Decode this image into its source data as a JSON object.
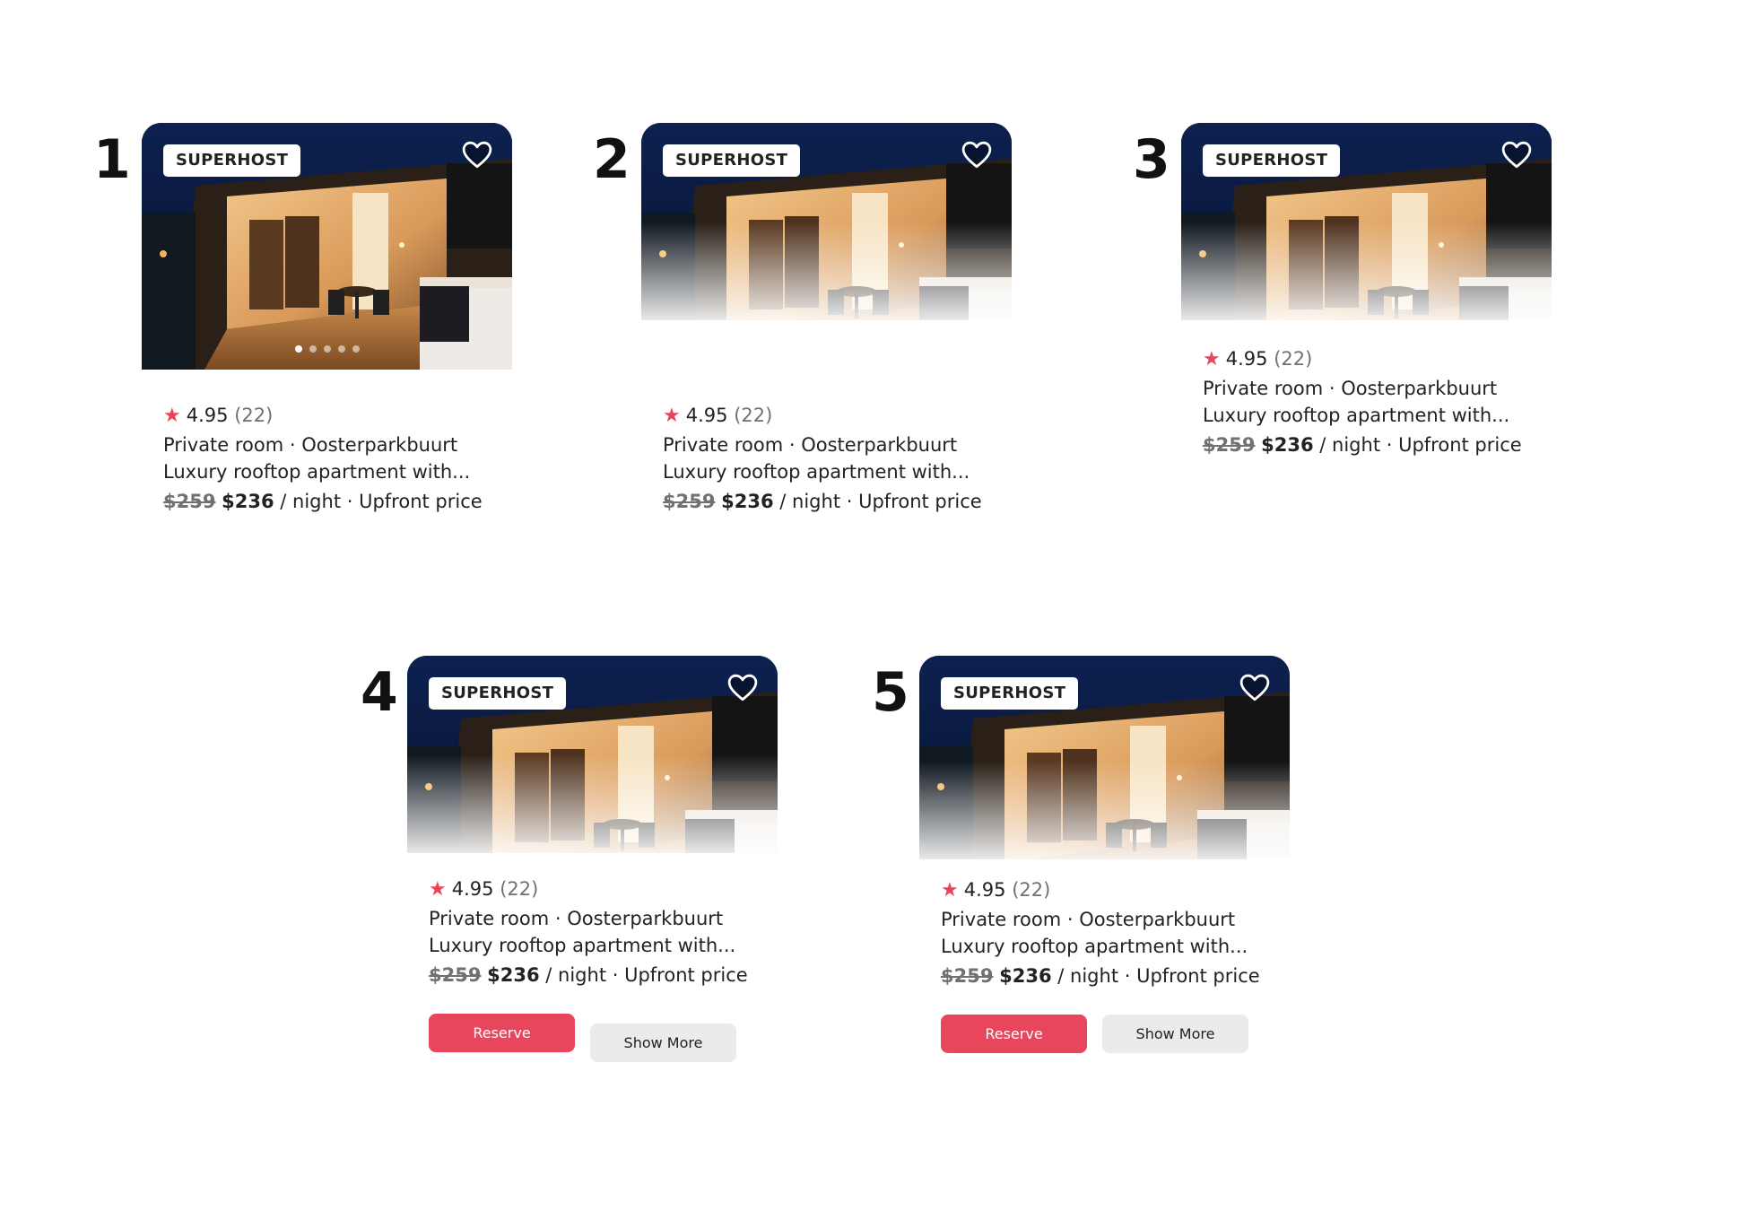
{
  "colors": {
    "accent": "#e8465c",
    "star": "#e8455b",
    "secondary_button_bg": "#ebebeb"
  },
  "listing": {
    "badge": "SUPERHOST",
    "rating": "4.95",
    "reviews": "(22)",
    "room_type": "Private room · Oosterparkbuurt",
    "title": "Luxury rooftop apartment with...",
    "old_price": "$259",
    "new_price": "$236",
    "price_suffix": "/ night · Upfront price",
    "heart_icon": "heart-outline-icon",
    "star_icon": "star-icon"
  },
  "variants": [
    {
      "number": "1",
      "carousel_dots": 5
    },
    {
      "number": "2"
    },
    {
      "number": "3"
    },
    {
      "number": "4",
      "reserve_label": "Reserve",
      "more_label": "Show More"
    },
    {
      "number": "5",
      "reserve_label": "Reserve",
      "more_label": "Show More"
    }
  ]
}
